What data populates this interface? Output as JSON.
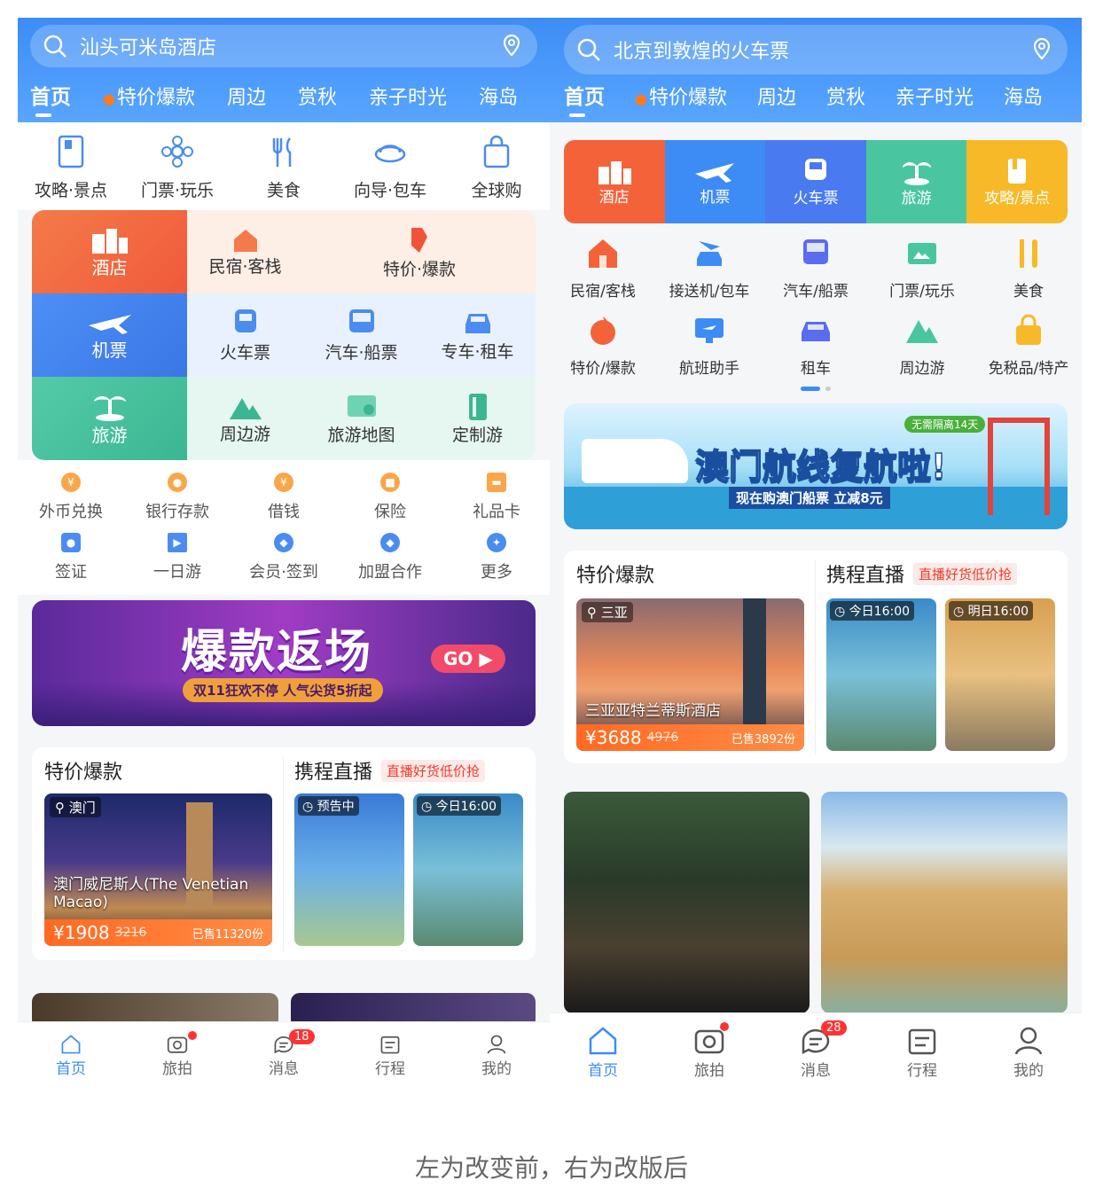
{
  "left": {
    "search_placeholder": "汕头可米岛酒店",
    "tabs": [
      "首页",
      "特价爆款",
      "周边",
      "赏秋",
      "亲子时光",
      "海岛"
    ],
    "top_icons": [
      "攻略·景点",
      "门票·玩乐",
      "美食",
      "向导·包车",
      "全球购"
    ],
    "grid": {
      "hotel": "酒店",
      "homestay": "民宿·客栈",
      "deals": "特价·爆款",
      "flight": "机票",
      "train": "火车票",
      "bus_ship": "汽车·船票",
      "car_rental": "专车·租车",
      "travel": "旅游",
      "nearby": "周边游",
      "map": "旅游地图",
      "custom": "定制游"
    },
    "small_row1": [
      "外币兑换",
      "银行存款",
      "借钱",
      "保险",
      "礼品卡"
    ],
    "small_row2": [
      "签证",
      "一日游",
      "会员·签到",
      "加盟合作",
      "更多"
    ],
    "banner": {
      "title": "爆款返场",
      "go": "GO",
      "sub": "双11狂欢不停 人气尖货5折起"
    },
    "deals": {
      "title": "特价爆款",
      "location": "澳门",
      "name": "澳门威尼斯人(The Venetian Macao)",
      "price": "¥1908",
      "old_price": "3216",
      "sold": "已售11320份"
    },
    "live": {
      "title": "携程直播",
      "tagline": "直播好货低价抢",
      "status1": "预告中",
      "status2": "今日16:00"
    },
    "nav": [
      "首页",
      "旅拍",
      "消息",
      "行程",
      "我的"
    ],
    "msg_badge": "18"
  },
  "right": {
    "search_placeholder": "北京到敦煌的火车票",
    "tabs": [
      "首页",
      "特价爆款",
      "周边",
      "赏秋",
      "亲子时光",
      "海岛"
    ],
    "top5": [
      "酒店",
      "机票",
      "火车票",
      "旅游",
      "攻略/景点"
    ],
    "row1": [
      "民宿/客栈",
      "接送机/包车",
      "汽车/船票",
      "门票/玩乐",
      "美食"
    ],
    "row2": [
      "特价/爆款",
      "航班助手",
      "租车",
      "周边游",
      "免税品/特产"
    ],
    "banner": {
      "title": "澳门航线复航啦!",
      "sub": "现在购澳门船票 立减8元",
      "badge": "无需隔离14天"
    },
    "deals": {
      "title": "特价爆款",
      "location": "三亚",
      "name": "三亚亚特兰蒂斯酒店",
      "price": "¥3688",
      "old_price": "4976",
      "sold": "已售3892份"
    },
    "live": {
      "title": "携程直播",
      "tagline": "直播好货低价抢",
      "status1": "今日16:00",
      "status2": "明日16:00"
    },
    "nav": [
      "首页",
      "旅拍",
      "消息",
      "行程",
      "我的"
    ],
    "msg_badge": "28"
  },
  "caption": "左为改变前，右为改版后",
  "colors": {
    "blue": "#3d8cf5",
    "orange": "#f4623a",
    "green": "#49c6a0",
    "yellow": "#f7b928"
  }
}
